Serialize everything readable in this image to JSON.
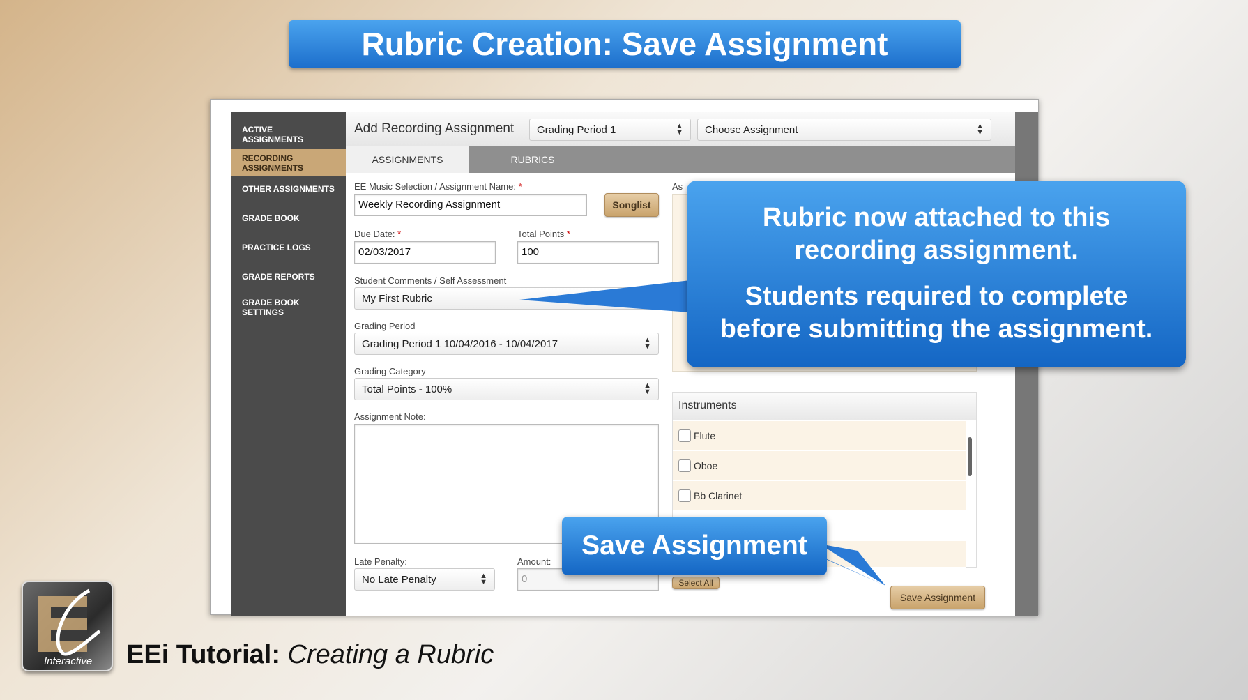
{
  "banner": {
    "title": "Rubric Creation: Save Assignment"
  },
  "sidebar": {
    "items": [
      {
        "label": "ACTIVE ASSIGNMENTS"
      },
      {
        "label": "RECORDING ASSIGNMENTS"
      },
      {
        "label": "OTHER ASSIGNMENTS"
      },
      {
        "label": "GRADE BOOK"
      },
      {
        "label": "PRACTICE LOGS"
      },
      {
        "label": "GRADE REPORTS"
      },
      {
        "label": "GRADE BOOK SETTINGS"
      }
    ]
  },
  "header": {
    "title": "Add Recording Assignment",
    "period_select": "Grading Period 1",
    "assignment_select": "Choose Assignment"
  },
  "tabs": [
    {
      "label": "ASSIGNMENTS"
    },
    {
      "label": "RUBRICS"
    }
  ],
  "form": {
    "name_label": "EE Music Selection / Assignment Name:",
    "name_value": "Weekly Recording Assignment",
    "songlist_label": "Songlist",
    "due_label": "Due Date:",
    "due_value": "02/03/2017",
    "points_label": "Total Points",
    "points_value": "100",
    "comments_label": "Student Comments / Self Assessment",
    "comments_value": "My First Rubric",
    "period_label": "Grading Period",
    "period_value": "Grading Period 1 10/04/2016 - 10/04/2017",
    "category_label": "Grading Category",
    "category_value": "Total Points - 100%",
    "note_label": "Assignment Note:",
    "late_label": "Late Penalty:",
    "late_value": "No Late Penalty",
    "amount_label": "Amount:",
    "amount_value": "0",
    "required_marker": "*",
    "right_column_label_fragment": "As"
  },
  "instruments": {
    "title": "Instruments",
    "items": [
      {
        "label": "Flute"
      },
      {
        "label": "Oboe"
      },
      {
        "label": "Bb Clarinet"
      }
    ],
    "select_all_label": "Select All",
    "save_label": "Save Assignment"
  },
  "callouts": {
    "rubric_line1": "Rubric now attached to this",
    "rubric_line2": "recording assignment.",
    "students_line1": "Students required to complete",
    "students_line2": "before submitting the assignment.",
    "save": "Save Assignment"
  },
  "footer": {
    "bold": "EEi Tutorial:",
    "italic": "Creating a Rubric"
  },
  "logo": {
    "text": "Interactive",
    "icon": "eei-logo-icon"
  },
  "colors": {
    "accent_blue": "#1d6fcc",
    "tan": "#c9a777",
    "sidebar": "#4b4b4b"
  }
}
